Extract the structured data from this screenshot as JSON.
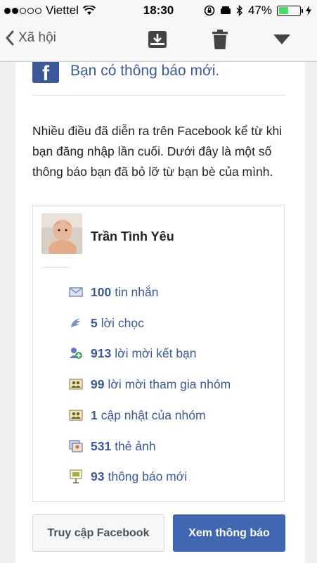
{
  "status_bar": {
    "carrier": "Viettel",
    "time": "18:30",
    "battery_percent": "47%",
    "battery_level": 0.47,
    "signal_bars": 2
  },
  "nav": {
    "back_label": "Xã hội",
    "icons": [
      "archive-icon",
      "trash-icon",
      "dropdown-icon"
    ]
  },
  "email": {
    "header_text": "Bạn có thông báo mới.",
    "intro": "Nhiều điều đã diễn ra trên Facebook kể từ khi bạn đăng nhập lần cuối. Dưới đây là một số thông báo bạn đã bỏ lỡ từ bạn bè của mình.",
    "user_name": "Trần Tình Yêu",
    "notifications": [
      {
        "icon": "message-icon",
        "count": "100",
        "text": "tin nhắn"
      },
      {
        "icon": "poke-icon",
        "count": "5",
        "text": "lời chọc"
      },
      {
        "icon": "friend-request-icon",
        "count": "913",
        "text": "lời mời kết bạn"
      },
      {
        "icon": "group-icon",
        "count": "99",
        "text": "lời mời tham gia nhóm"
      },
      {
        "icon": "group-icon",
        "count": "1",
        "text": "cập nhật của nhóm"
      },
      {
        "icon": "photo-tag-icon",
        "count": "531",
        "text": "thẻ ảnh"
      },
      {
        "icon": "notification-icon",
        "count": "93",
        "text": "thông báo mới"
      }
    ],
    "buttons": {
      "visit": "Truy cập Facebook",
      "view": "Xem thông báo"
    },
    "colors": {
      "brand": "#3b5998",
      "primary_button": "#4267b2"
    }
  }
}
